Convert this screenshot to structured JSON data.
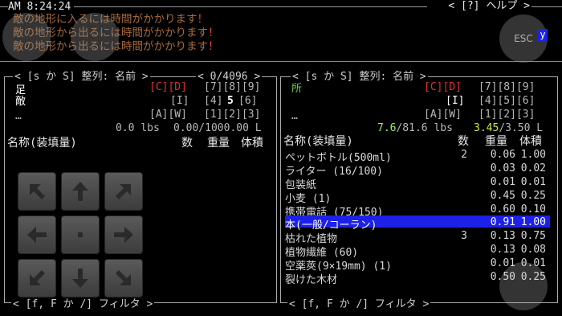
{
  "status": {
    "time": "AM 8:24:24"
  },
  "help": {
    "label": "< [?] ヘルプ >"
  },
  "messages": [
    {
      "text": "敵の地形に入るには時間がかかります",
      "excl": "！"
    },
    {
      "text": "敵の地形から出るには時間がかかります",
      "excl": "！"
    },
    {
      "text": "敵の地形から出るには時間がかかります",
      "excl": "！"
    }
  ],
  "overlay": {
    "esc": "ESC",
    "cursor": "y"
  },
  "left_panel": {
    "title_prefix": "< [s か S] 整列: 名前 >",
    "count": "< 0/4096 >",
    "locs": [
      "足",
      "敵"
    ],
    "ellipsis": "…",
    "grid_row1": "[C][D]",
    "grid_row1_rest": "[7][8][9]",
    "grid_row2": "[I]",
    "grid_row2_a": "[4]",
    "grid_row2_b": "5",
    "grid_row2_c": "[6]",
    "grid_row3_a": "[A][W]",
    "grid_row3_b": "[1][2][3]",
    "weight": "0.0 lbs",
    "volume": "0.00/1000.00 L",
    "col_name": "名称(装填量)",
    "col_qty": "数",
    "col_weight": "重量",
    "col_volume": "体積",
    "footer": "< [f, F か /] フィルタ >"
  },
  "right_panel": {
    "title": "< [s か S] 整列: 名前 >",
    "loc": "所",
    "ellipsis": "…",
    "grid_row1": "[C][D]",
    "grid_row1_rest": "[7][8][9]",
    "grid_row2": "[I]",
    "grid_row2_rest": "[4][5][6]",
    "grid_row3_a": "[A][W]",
    "grid_row3_b": "[1][2][3]",
    "weight_cur": "7.6",
    "weight_max": "/81.6 lbs",
    "vol_cur": "3.45",
    "vol_max": "/3.50 L",
    "col_name": "名称(装填量)",
    "col_qty": "数",
    "col_weight": "重量",
    "col_volume": "体積",
    "items": [
      {
        "name": "ペットボトル(500ml)",
        "qty": "2",
        "weight": "0.06",
        "volume": "1.00"
      },
      {
        "name": "ライター (16/100)",
        "qty": "",
        "weight": "0.03",
        "volume": "0.02"
      },
      {
        "name": "包装紙",
        "qty": "",
        "weight": "0.01",
        "volume": "0.01"
      },
      {
        "name": "小麦 (1)",
        "qty": "",
        "weight": "0.45",
        "volume": "0.25"
      },
      {
        "name": "携帯電話 (75/150)",
        "qty": "",
        "weight": "0.60",
        "volume": "0.10"
      },
      {
        "name": "本(一般/コーラン)",
        "qty": "",
        "weight": "0.91",
        "volume": "1.00"
      },
      {
        "name": "枯れた植物",
        "qty": "3",
        "weight": "0.13",
        "volume": "0.75"
      },
      {
        "name": "植物繊維 (60)",
        "qty": "",
        "weight": "0.13",
        "volume": "0.08"
      },
      {
        "name": "空薬莢(9×19mm) (1)",
        "qty": "",
        "weight": "0.01",
        "volume": "0.01"
      },
      {
        "name": "裂けた木材",
        "qty": "",
        "weight": "0.50",
        "volume": "0.25"
      }
    ],
    "footer": "< [f, F か /] フィルタ >"
  },
  "dpad_icons": [
    "arrow-up-left-icon",
    "arrow-up-icon",
    "arrow-up-right-icon",
    "arrow-left-icon",
    "center-dot-icon",
    "arrow-right-icon",
    "arrow-down-left-icon",
    "arrow-down-icon",
    "arrow-down-right-icon"
  ]
}
